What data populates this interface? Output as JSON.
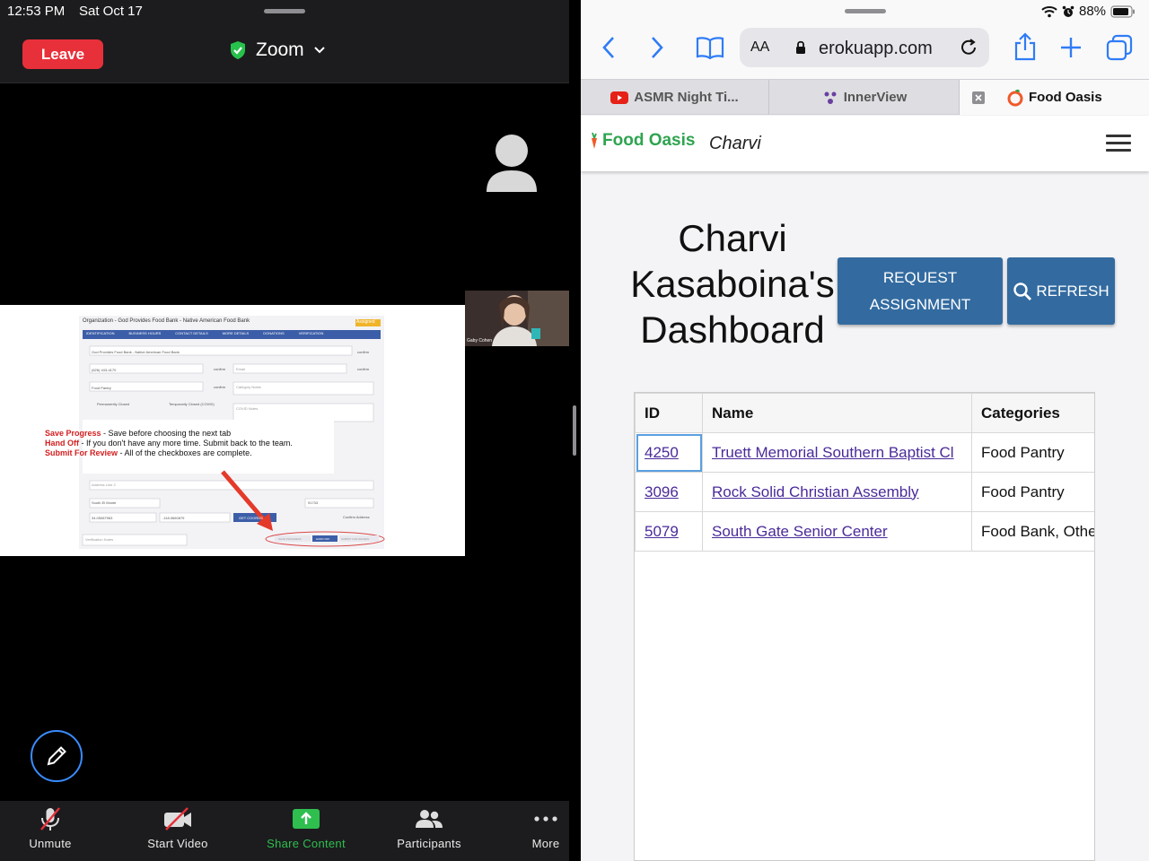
{
  "status": {
    "time": "12:53 PM",
    "date": "Sat Oct 17",
    "battery": "88%"
  },
  "zoom": {
    "leave_label": "Leave",
    "title": "Zoom",
    "participant_thumb_name": "Gaby Cohen",
    "toolbar": [
      {
        "label": "Unmute",
        "icon": "mic-muted-icon"
      },
      {
        "label": "Start Video",
        "icon": "video-off-icon"
      },
      {
        "label": "Share Content",
        "icon": "share-screen-icon"
      },
      {
        "label": "Participants",
        "icon": "participants-icon"
      },
      {
        "label": "More",
        "icon": "more-dots-icon"
      }
    ],
    "slide": {
      "header": "Organization - God Provides Food Bank - Native American Food Bank",
      "badge": "Assigned",
      "tabs": [
        "IDENTIFICATION",
        "BUSINESS HOURS",
        "CONTACT DETAILS",
        "MORE DETAILS",
        "DONATIONS",
        "VERIFICATION"
      ],
      "note_lines": [
        {
          "key": "Save Progress",
          "text": " - Save before choosing the next tab"
        },
        {
          "key": "Hand Off",
          "text": " - If you don't have any more time. Submit back to the team."
        },
        {
          "key": "Submit For Review",
          "text": " - All of the checkboxes are complete."
        }
      ],
      "fields": {
        "name": "God Provides Food Bank - Native American Food Bank",
        "phone": "(626) 443-4170",
        "category": "Food Pantry",
        "city": "South El Monte",
        "zip": "91733",
        "lat": "34.05087963",
        "lng": "-118.0660879"
      },
      "labels": {
        "confirm": "confirm",
        "email": "Email",
        "category_notes": "Category Notes",
        "perm_closed": "Permanently Closed",
        "temp_closed": "Temporarily Closed (COVID)",
        "covid_notes": "COVID Notes",
        "address2": "Address Line 2",
        "confirm_address": "Confirm Address",
        "verification_notes": "Verification Notes",
        "get_coords": "GET COORDS",
        "save": "SAVE PROGRESS",
        "handoff": "HAND OFF",
        "submit": "SUBMIT FOR REVIEW"
      }
    }
  },
  "safari": {
    "url": "erokuapp.com",
    "text_size_label": "AA",
    "tabs": [
      {
        "label": "ASMR Night Ti...",
        "icon": "youtube-icon"
      },
      {
        "label": "InnerView",
        "icon": "innerview-icon"
      },
      {
        "label": "Food Oasis",
        "icon": "food-oasis-icon"
      }
    ],
    "site": {
      "brand": "Food Oasis",
      "user": "Charvi",
      "dashboard_title": "Charvi Kasaboina's Dashboard",
      "request_label": "REQUEST ASSIGNMENT",
      "refresh_label": "REFRESH",
      "table": {
        "headers": [
          "ID",
          "Name",
          "Categories"
        ],
        "rows": [
          {
            "id": "4250",
            "name": "Truett Memorial Southern Baptist Cl",
            "categories": "Food Pantry"
          },
          {
            "id": "3096",
            "name": "Rock Solid Christian Assembly",
            "categories": "Food Pantry"
          },
          {
            "id": "5079",
            "name": "South Gate Senior Center",
            "categories": "Food Bank, Othe"
          }
        ]
      }
    }
  }
}
